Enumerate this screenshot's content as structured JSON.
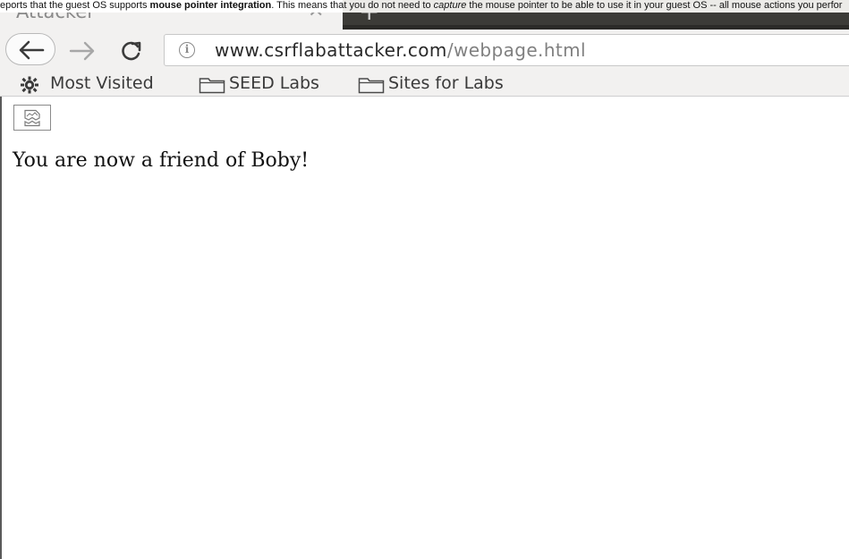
{
  "notification": {
    "prefix": "eports that the guest OS supports ",
    "bold": "mouse pointer integration",
    "middle": ". This means that you do not need to ",
    "italic": "capture",
    "suffix": " the mouse pointer to be able to use it in your guest OS -- all mouse actions you perfor"
  },
  "tab": {
    "title": "Attacker",
    "close_glyph": "✕",
    "new_tab_glyph": "+"
  },
  "navbar": {
    "url_domain": "www.csrflabattacker.com",
    "url_path": "/webpage.html",
    "info_glyph": "i"
  },
  "bookmarks": [
    {
      "label": "Most Visited",
      "icon": "gear-icon"
    },
    {
      "label": "SEED Labs",
      "icon": "folder-icon"
    },
    {
      "label": "Sites for Labs",
      "icon": "folder-icon"
    }
  ],
  "page": {
    "message": "You are now a friend of Boby!",
    "image_icon": "broken-image-icon"
  }
}
